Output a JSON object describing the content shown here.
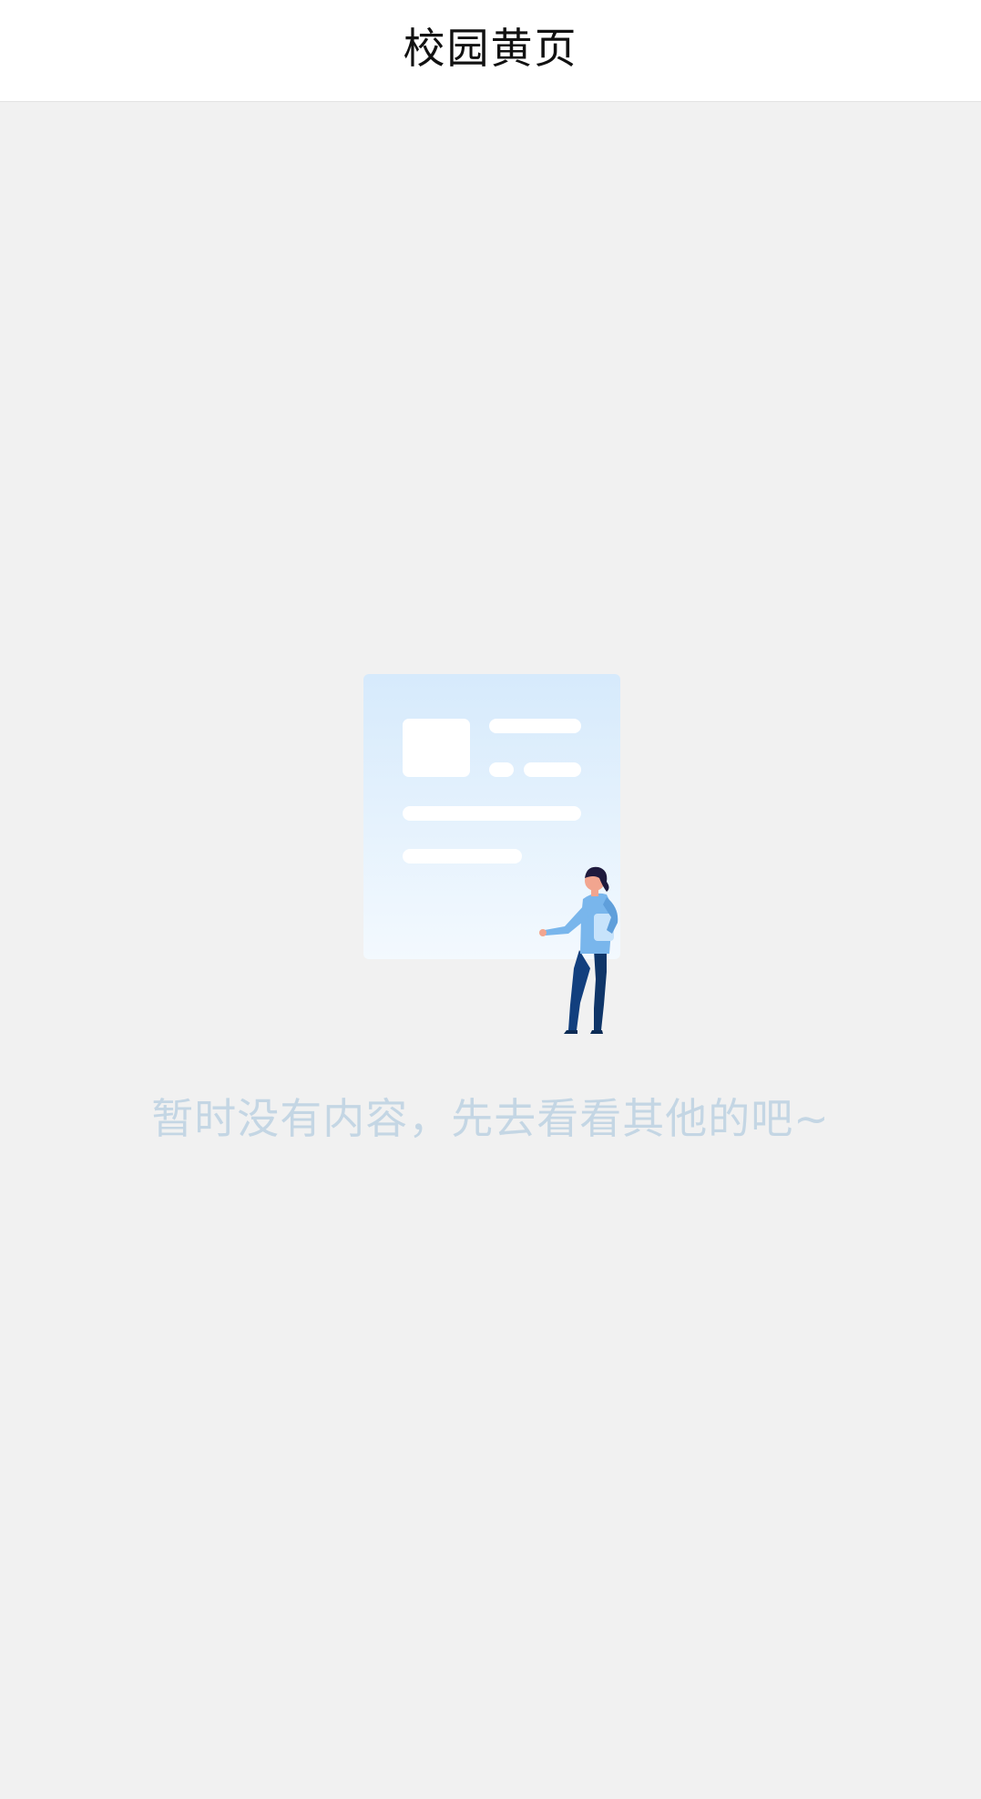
{
  "header": {
    "title": "校园黄页"
  },
  "empty_state": {
    "message": "暂时没有内容，先去看看其他的吧~",
    "illustration": "empty-content-illustration"
  },
  "colors": {
    "background": "#f1f1f1",
    "header_background": "#ffffff",
    "title_text": "#111111",
    "empty_text": "#c4d6e4",
    "card_gradient_top": "#d6eafc",
    "card_gradient_bottom": "#f3f9fe",
    "figure_shirt": "#79b6ec",
    "figure_pants": "#123f7e",
    "figure_hair": "#1f1a3d"
  }
}
